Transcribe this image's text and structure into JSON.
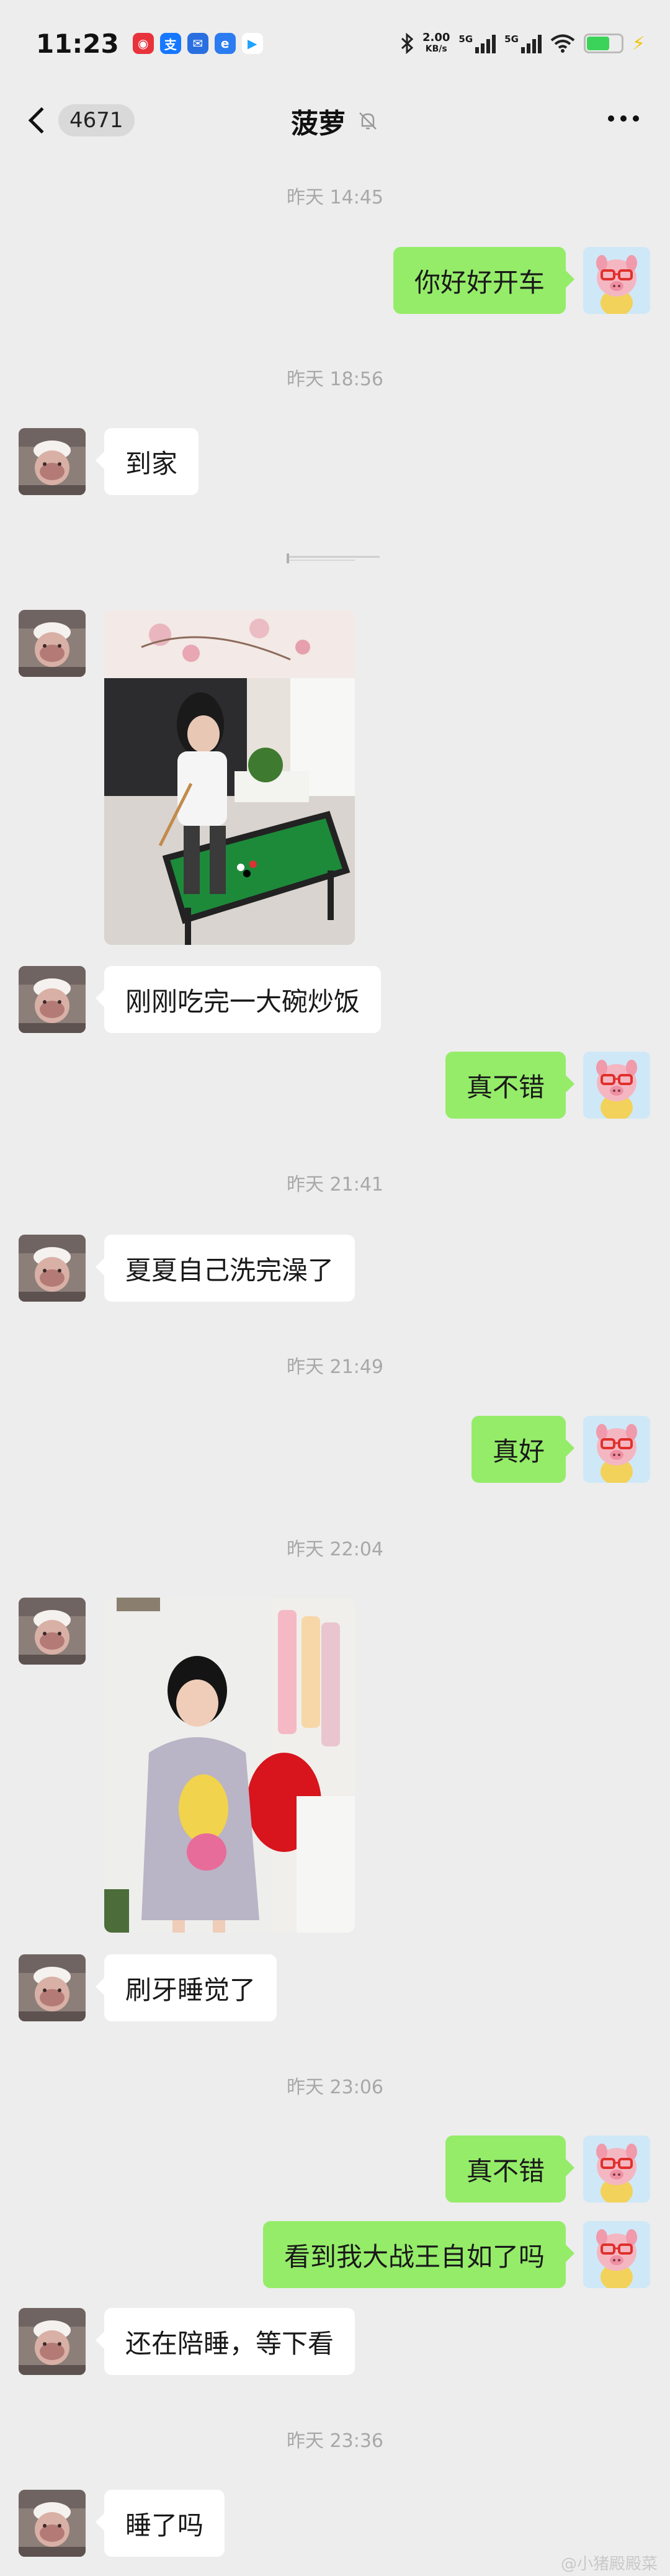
{
  "status_bar": {
    "time": "11:23",
    "net_speed": "2.00",
    "net_unit": "KB/s",
    "sig1": "5G",
    "sig2": "5G",
    "notification_icons": [
      "netease-music-icon",
      "alipay-icon",
      "messages-icon",
      "browser-icon",
      "video-app-icon"
    ]
  },
  "nav": {
    "unread_count": "4671",
    "title": "菠萝"
  },
  "colors": {
    "background": "#ededed",
    "my_bubble": "#95ec69",
    "their_bubble": "#ffffff",
    "timestamp": "#a8a8a8"
  },
  "messages": {
    "t1": "昨天 14:45",
    "m1": "你好好开车",
    "t2": "昨天 18:56",
    "m2": "到家",
    "m3": "刚刚吃完一大碗炒饭",
    "m4": "真不错",
    "t3": "昨天 21:41",
    "m5": "夏夏自己洗完澡了",
    "t4": "昨天 21:49",
    "m6": "真好",
    "t5": "昨天 22:04",
    "m7": "刷牙睡觉了",
    "t6": "昨天 23:06",
    "m8": "真不错",
    "m9": "看到我大战王自如了吗",
    "m10": "还在陪睡，等下看",
    "t7": "昨天 23:36",
    "m11": "睡了吗"
  },
  "watermark": "@小猪殿殿菜"
}
